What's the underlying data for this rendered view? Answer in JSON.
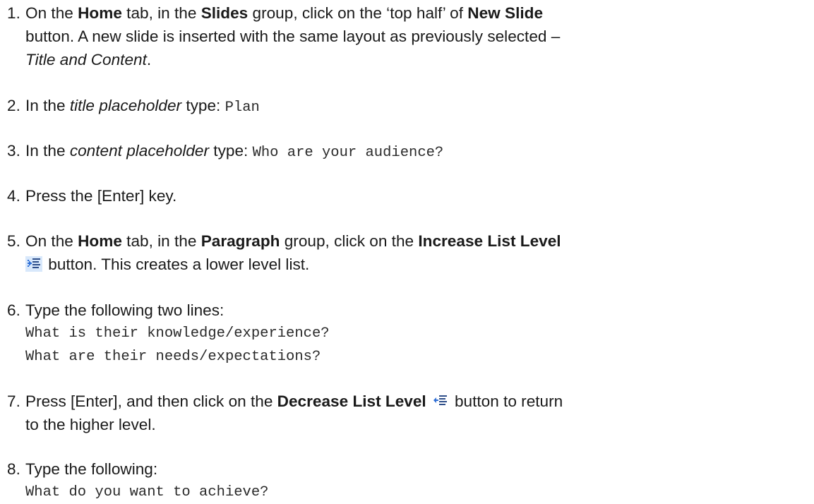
{
  "steps": [
    {
      "num": "1.",
      "l1a": "On the ",
      "l1b": "Home",
      "l1c": " tab, in the ",
      "l1d": "Slides",
      "l1e": " group, click on the ‘top half’ of ",
      "l1f": "New Slide",
      "l2": "button.  A new slide is inserted with the same layout as previously selected –",
      "l3": "Title and Content",
      "l3b": "."
    },
    {
      "num": "2.",
      "a": "In the ",
      "b": "title placeholder",
      "c": " type: ",
      "code": "Plan"
    },
    {
      "num": "3.",
      "a": "In the ",
      "b": "content placeholder",
      "c": " type: ",
      "code": "Who are your audience?"
    },
    {
      "num": "4.",
      "text": "Press the [Enter] key."
    },
    {
      "num": "5.",
      "l1a": "On the ",
      "l1b": "Home",
      "l1c": " tab, in the ",
      "l1d": "Paragraph",
      "l1e": " group, click on the ",
      "l1f": "Increase List Level",
      "icon": "increase-list-level-icon",
      "l2": " button.  This creates a lower level list."
    },
    {
      "num": "6.",
      "text": "Type the following two lines:",
      "code1": "What is their knowledge/experience?",
      "code2": "What are their needs/expectations?"
    },
    {
      "num": "7.",
      "a": "Press [Enter], and then click on the ",
      "b": "Decrease List Level",
      "icon": "decrease-list-level-icon",
      "c": " button to return",
      "l2": "to the higher level."
    },
    {
      "num": "8.",
      "text": "Type the following:",
      "code": "What do you want to achieve?"
    }
  ],
  "colors": {
    "icon_blue": "#2f6fd6",
    "icon_highlight": "#d8e8fb",
    "text": "#1a1a1a"
  }
}
